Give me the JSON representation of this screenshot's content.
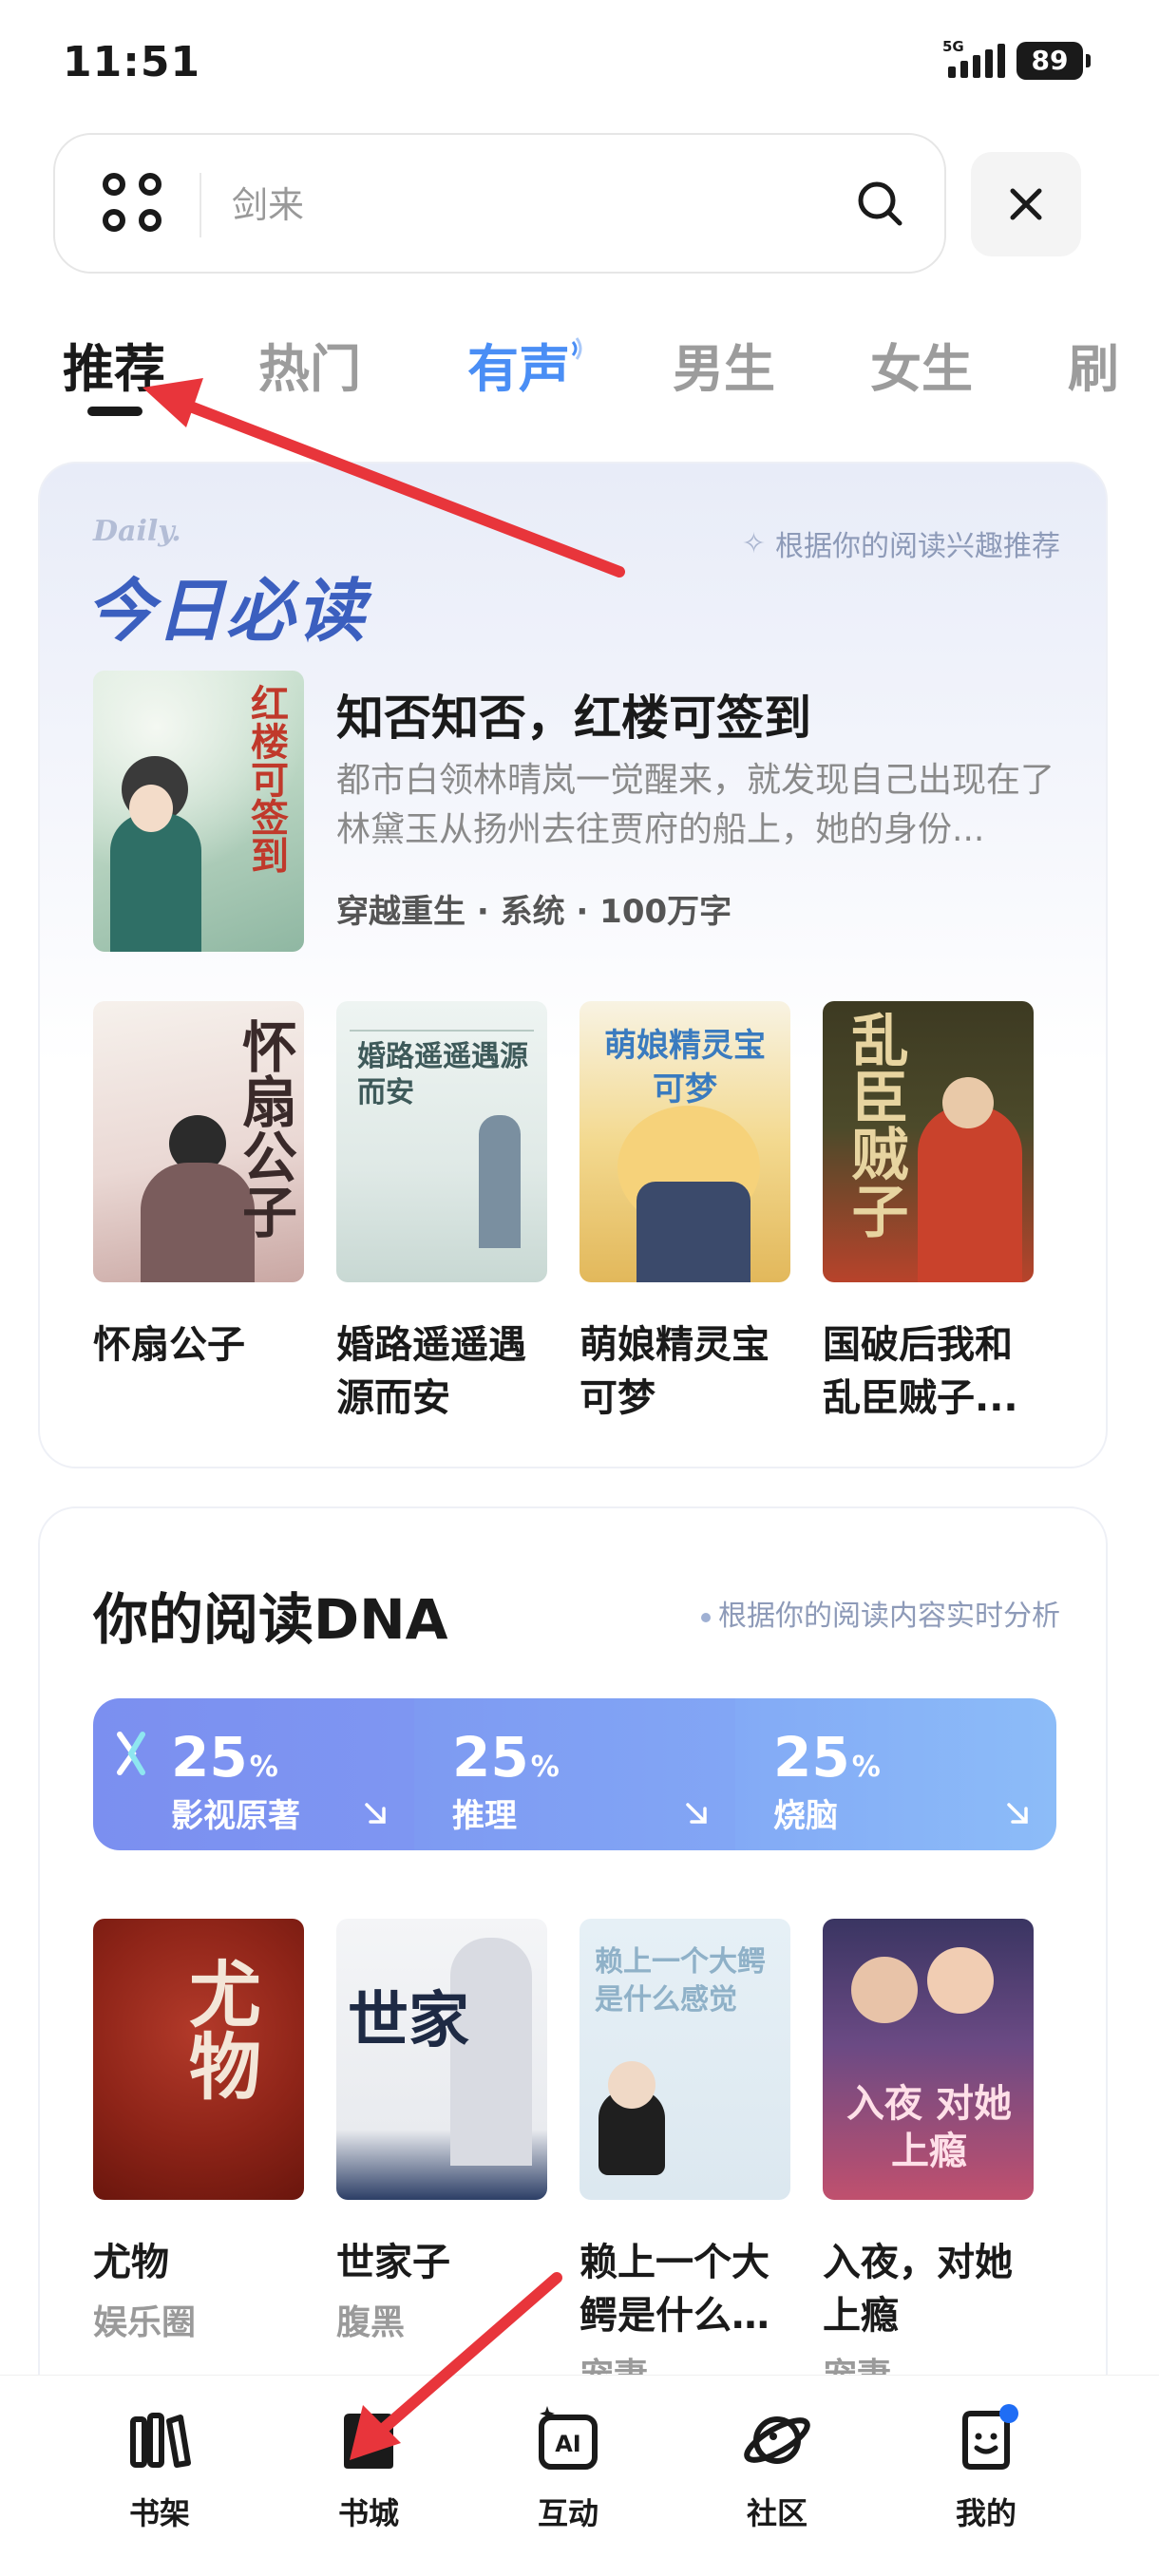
{
  "status_bar": {
    "time": "11:51",
    "network": "5G",
    "battery": "89"
  },
  "search": {
    "placeholder": "剑来"
  },
  "tabs": [
    {
      "label": "推荐"
    },
    {
      "label": "热门"
    },
    {
      "label": "有声"
    },
    {
      "label": "男生"
    },
    {
      "label": "女生"
    },
    {
      "label": "刷"
    }
  ],
  "daily": {
    "en_label": "Daily.",
    "title": "今日必读",
    "hint": "根据你的阅读兴趣推荐",
    "featured": {
      "title": "知否知否，红楼可签到",
      "desc": "都市白领林晴岚一觉醒来，就发现自己出现在了林黛玉从扬州去往贾府的船上，她的身份...",
      "meta": "穿越重生 · 系统 · 100万字",
      "cover_text": "红楼可签到"
    },
    "books": [
      {
        "title": "怀扇公子",
        "cover_text": "怀扇公子"
      },
      {
        "title": "婚路遥遥遇源而安",
        "cover_text": "婚路遥遥遇源而安"
      },
      {
        "title": "萌娘精灵宝可梦",
        "cover_text": "萌娘精灵宝可梦"
      },
      {
        "title": "国破后我和乱臣贼子...",
        "cover_text": "乱臣贼子"
      }
    ]
  },
  "dna": {
    "title": "你的阅读DNA",
    "hint": "根据你的阅读内容实时分析",
    "segments": [
      {
        "percent": "25",
        "unit": "%",
        "label": "影视原著"
      },
      {
        "percent": "25",
        "unit": "%",
        "label": "推理"
      },
      {
        "percent": "25",
        "unit": "%",
        "label": "烧脑"
      }
    ],
    "books": [
      {
        "title": "尤物",
        "tag": "娱乐圈",
        "cover_text": "尤物"
      },
      {
        "title": "世家子",
        "tag": "腹黑",
        "cover_text": "世家"
      },
      {
        "title": "赖上一个大鳄是什么感觉",
        "tag": "宠妻",
        "cover_text": "赖上一个大鳄是什么感觉"
      },
      {
        "title": "入夜，对她上瘾",
        "tag": "宠妻",
        "cover_text": "入夜 对她上瘾"
      }
    ]
  },
  "bottom_nav": [
    {
      "label": "书架",
      "icon": "bookshelf-icon"
    },
    {
      "label": "书城",
      "icon": "bookstore-icon"
    },
    {
      "label": "互动",
      "icon": "ai-interact-icon"
    },
    {
      "label": "社区",
      "icon": "planet-icon"
    },
    {
      "label": "我的",
      "icon": "profile-icon"
    }
  ],
  "colors": {
    "accent_blue": "#4a8ef5",
    "daily_title": "#3b5fbf",
    "annotation_red": "#e8353b",
    "notification_dot": "#1f6df5"
  }
}
